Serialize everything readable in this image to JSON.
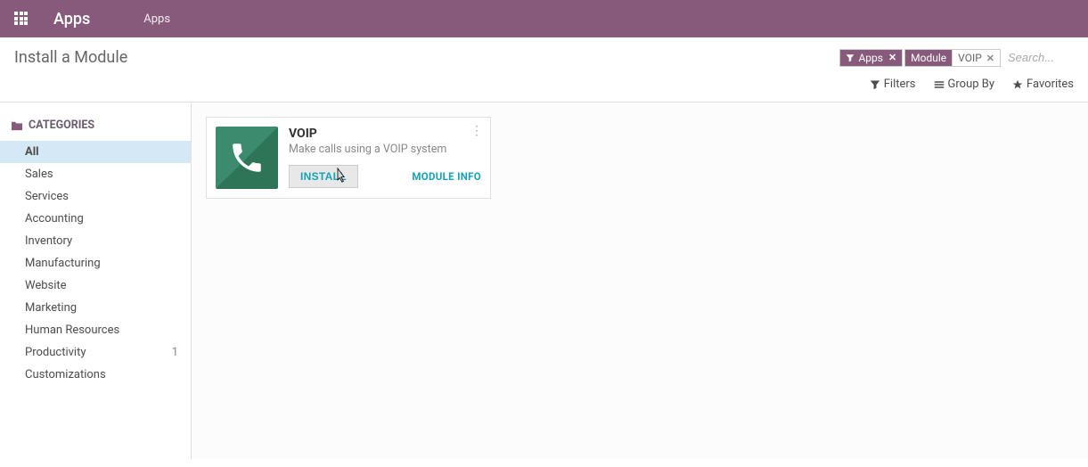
{
  "header": {
    "app_name": "Apps",
    "breadcrumb": "Apps"
  },
  "page": {
    "title": "Install a Module"
  },
  "search": {
    "placeholder": "Search...",
    "facets": [
      {
        "type": "filter",
        "label": "Apps"
      },
      {
        "type": "field",
        "field": "Module",
        "value": "VOIP"
      }
    ]
  },
  "toolbar": {
    "filters_label": "Filters",
    "group_by_label": "Group By",
    "favorites_label": "Favorites"
  },
  "sidebar": {
    "header": "CATEGORIES",
    "items": [
      {
        "label": "All",
        "active": true
      },
      {
        "label": "Sales"
      },
      {
        "label": "Services"
      },
      {
        "label": "Accounting"
      },
      {
        "label": "Inventory"
      },
      {
        "label": "Manufacturing"
      },
      {
        "label": "Website"
      },
      {
        "label": "Marketing"
      },
      {
        "label": "Human Resources"
      },
      {
        "label": "Productivity",
        "count": "1"
      },
      {
        "label": "Customizations"
      }
    ]
  },
  "modules": [
    {
      "name": "VOIP",
      "description": "Make calls using a VOIP system",
      "install_label": "INSTALL",
      "info_label": "MODULE INFO",
      "icon": "phone-icon",
      "icon_bg": "#3c8b6e"
    }
  ]
}
